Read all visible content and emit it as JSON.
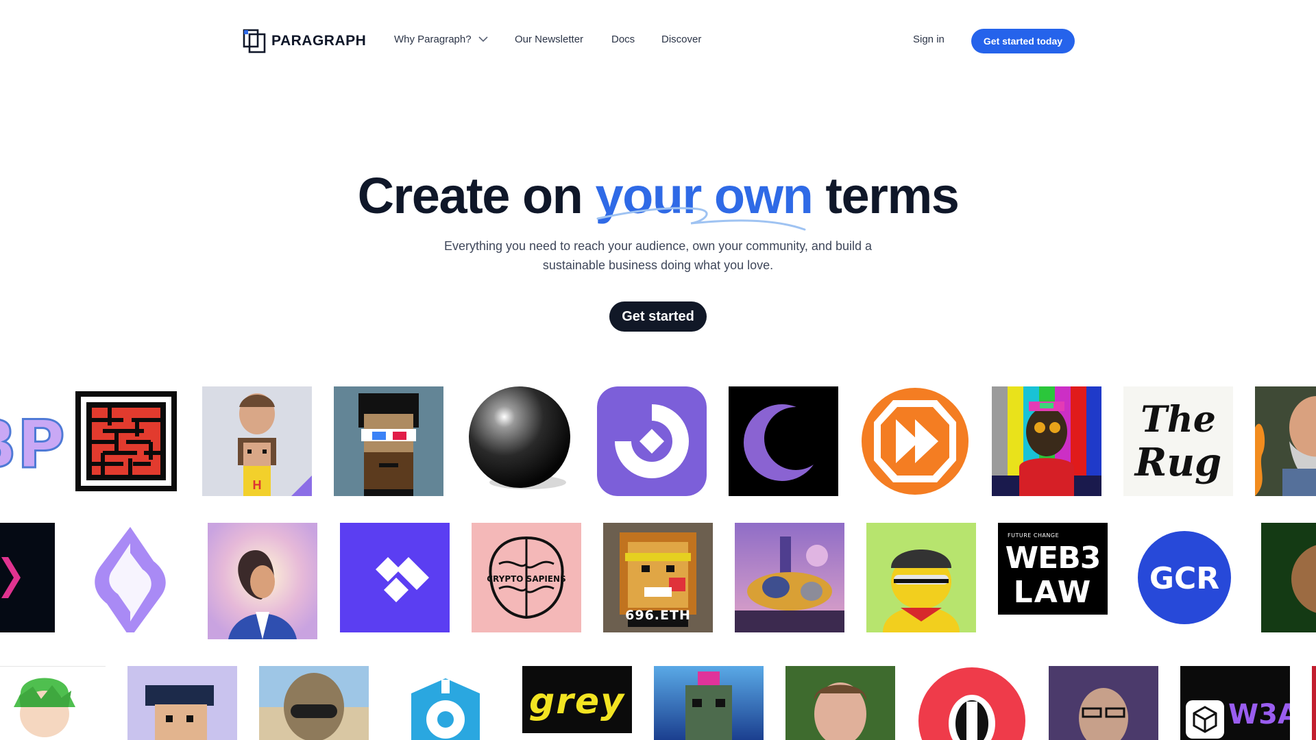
{
  "nav": {
    "brand": "PARAGRAPH",
    "links": [
      "Why Paragraph?",
      "Our Newsletter",
      "Docs",
      "Discover"
    ],
    "sign_in": "Sign in",
    "cta": "Get started today"
  },
  "hero": {
    "title_start": "Create on ",
    "title_accent": "your own",
    "title_end": " terms",
    "subtitle": "Everything you need to reach your audience, own your community, and build a sustainable business doing what you love.",
    "cta": "Get started"
  },
  "tiles": {
    "rug_line1": "The",
    "rug_line2": "Rug",
    "eth_name": "696.ETH",
    "law_small": "FUTURE CHANGE",
    "law_line1": "WEB3",
    "law_line2": "LAW",
    "gcr": "GCR",
    "grey": "grey",
    "brain": "CRYPTO SAPIENS",
    "w3a": "W3A"
  },
  "colors": {
    "accent": "#2f6ae6",
    "primary_button": "#2563eb",
    "dark_button": "#111827"
  }
}
